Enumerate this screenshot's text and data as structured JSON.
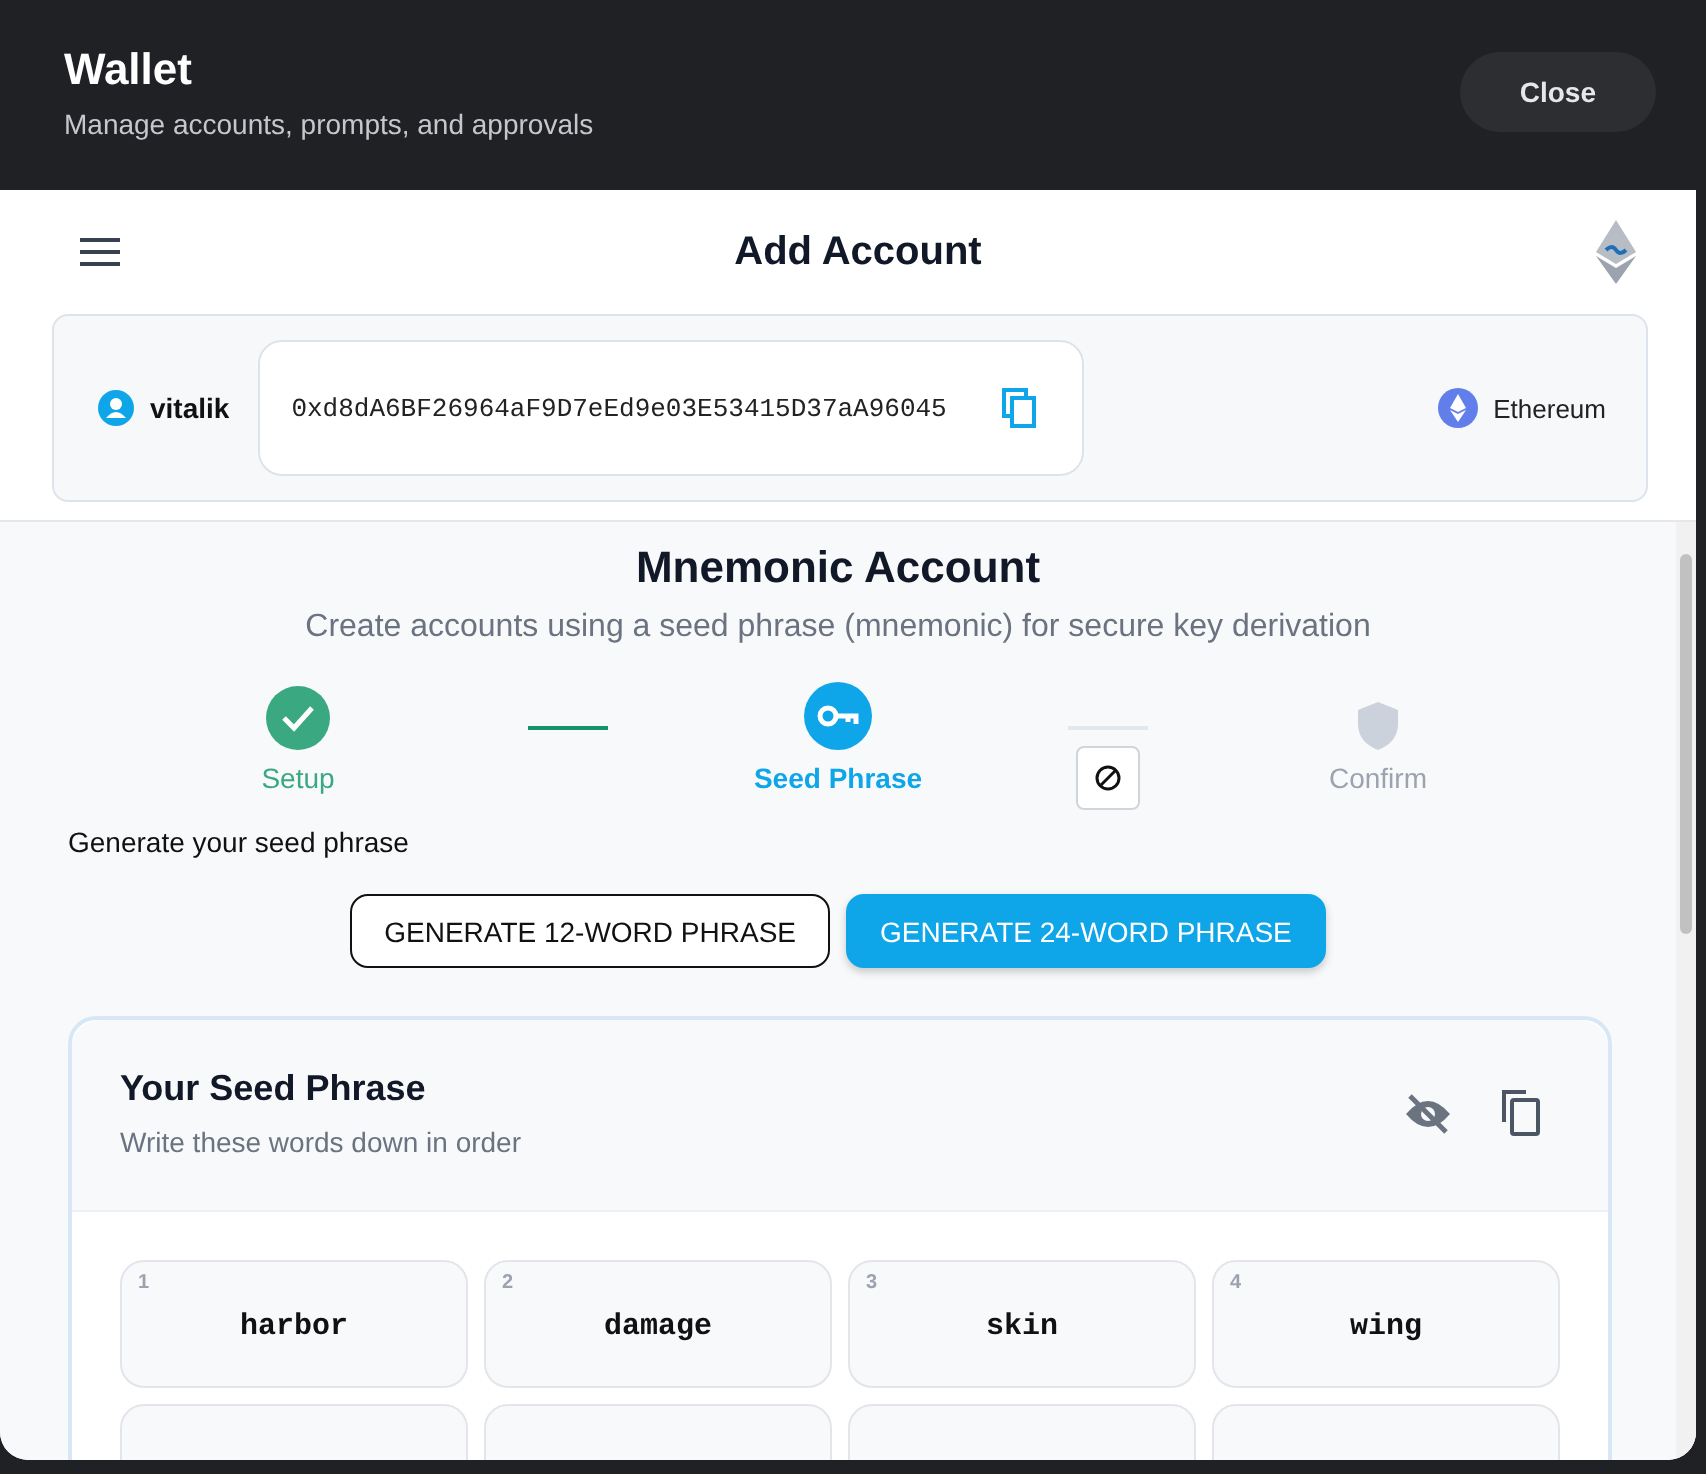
{
  "header": {
    "title": "Wallet",
    "subtitle": "Manage accounts, prompts, and approvals",
    "close_label": "Close"
  },
  "topbar": {
    "title": "Add Account"
  },
  "account": {
    "name": "vitalik",
    "address": "0xd8dA6BF26964aF9D7eEd9e03E53415D37aA96045",
    "network": "Ethereum"
  },
  "section": {
    "title": "Mnemonic Account",
    "subtitle": "Create accounts using a seed phrase (mnemonic) for secure key derivation"
  },
  "steps": [
    {
      "label": "Setup",
      "done": true,
      "selected": false
    },
    {
      "label": "Seed Phrase",
      "done": false,
      "selected": true
    },
    {
      "label": "Confirm",
      "done": false,
      "selected": false
    }
  ],
  "prompt": "Generate your seed phrase",
  "buttons": [
    {
      "label": "GENERATE 12-WORD PHRASE",
      "selected": false
    },
    {
      "label": "GENERATE 24-WORD PHRASE",
      "selected": true
    }
  ],
  "seed_card": {
    "title": "Your Seed Phrase",
    "subtitle": "Write these words down in order",
    "words": [
      {
        "index": "1",
        "word": "harbor"
      },
      {
        "index": "2",
        "word": "damage"
      },
      {
        "index": "3",
        "word": "skin"
      },
      {
        "index": "4",
        "word": "wing"
      }
    ]
  }
}
